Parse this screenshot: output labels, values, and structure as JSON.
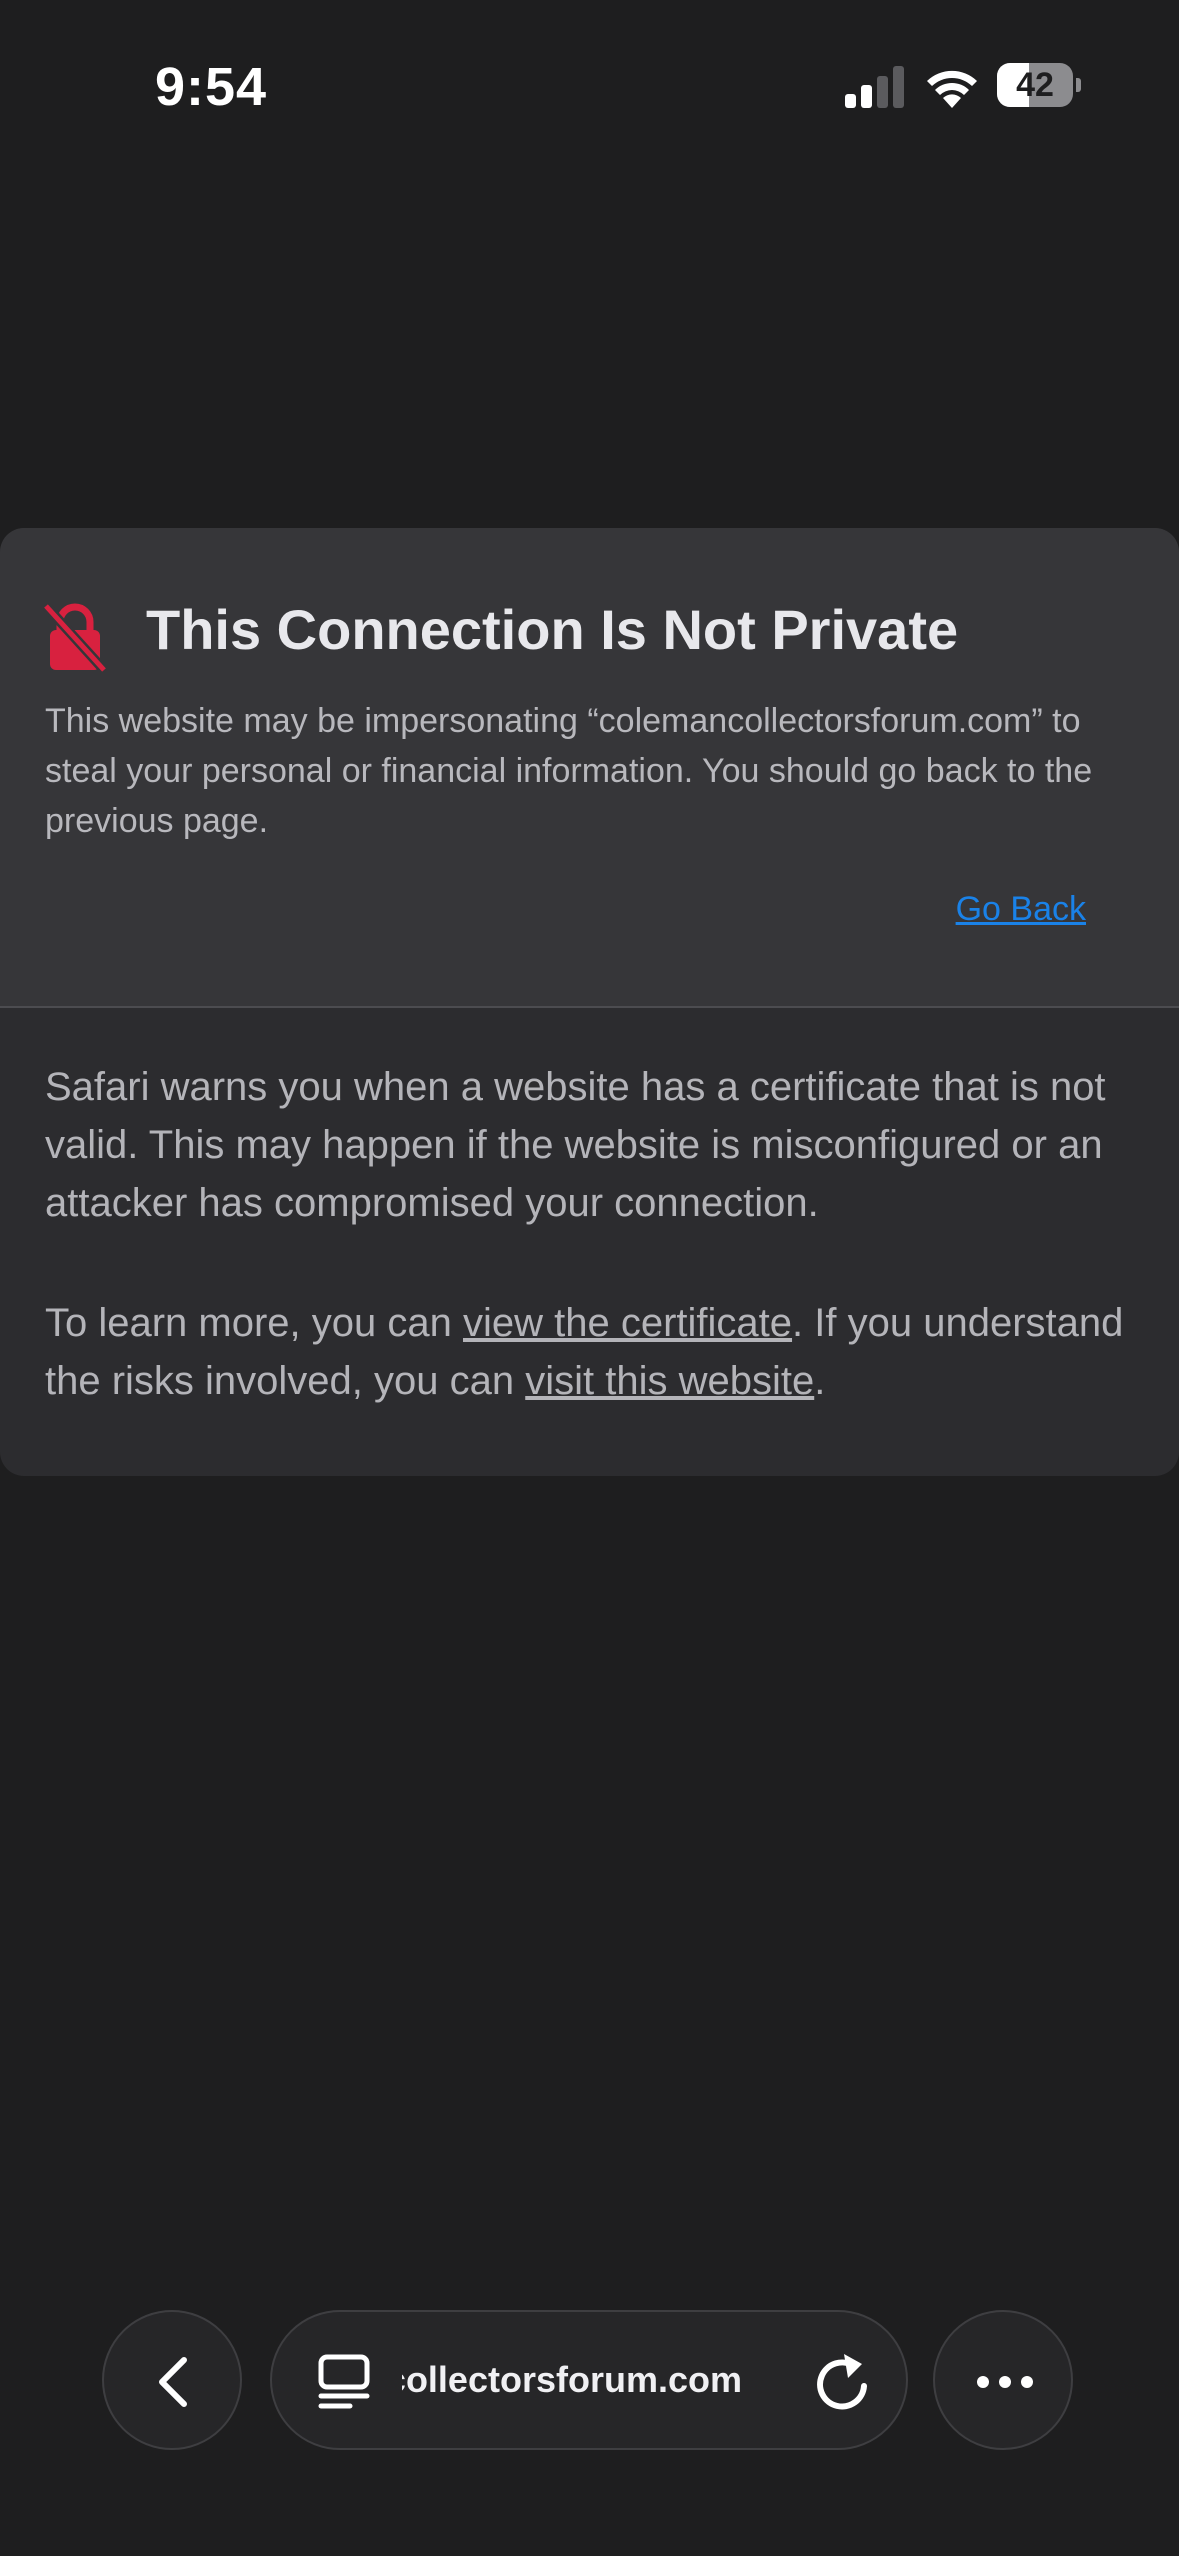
{
  "status_bar": {
    "time": "9:54",
    "battery_level": "42",
    "battery_fraction": 0.42,
    "signal_bars_active": 2,
    "signal_bars_total": 4
  },
  "warning": {
    "title": "This Connection Is Not Private",
    "message": "This website may be impersonating “colemancollectorsforum.com” to steal your personal or financial information. You should go back to the previous page.",
    "go_back_label": "Go Back",
    "explanation": "Safari warns you when a website has a certificate that is not valid. This may happen if the website is misconfigured or an attacker has compromised your connection.",
    "learn_prefix": "To learn more, you can ",
    "view_certificate_label": "view the certificate",
    "learn_middle": ". If you understand the risks involved, you can ",
    "visit_website_label": "visit this website",
    "learn_suffix": "."
  },
  "toolbar": {
    "url": "colemancollectorsforum.com",
    "back_icon": "chevron-left-icon",
    "tabs_icon": "tabs-icon",
    "reload_icon": "reload-icon",
    "more_icon": "ellipsis-icon"
  },
  "colors": {
    "background": "#1e1e1f",
    "card_top": "#363639",
    "card_bottom": "#2c2c2f",
    "link_blue": "#1a82e8",
    "lock_red": "#d8213f"
  }
}
